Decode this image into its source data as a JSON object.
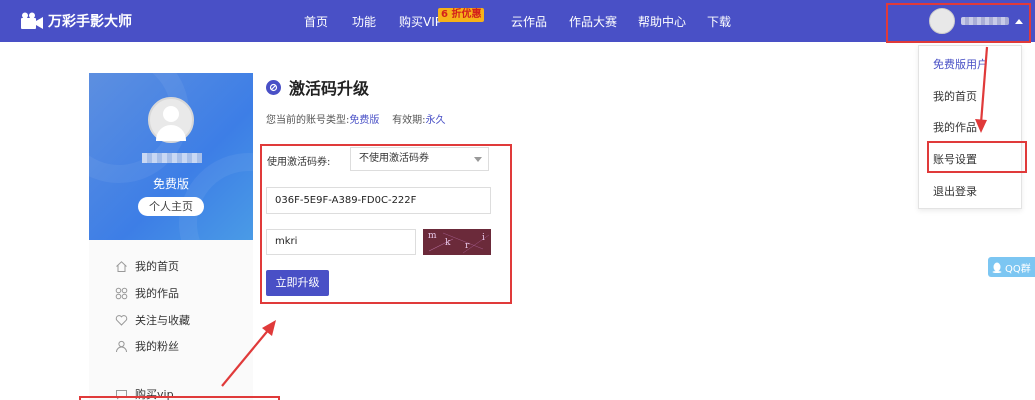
{
  "colors": {
    "brand": "#4950c6",
    "accent_red": "#e03a3a",
    "vip_badge": "#f6b21a",
    "link": "#4950c6"
  },
  "header": {
    "logo_text": "万彩手影大师",
    "logo_icon": "film-camera-icon",
    "nav": [
      "首页",
      "功能",
      "购买VIP",
      "云作品",
      "作品大赛",
      "帮助中心",
      "下载"
    ],
    "vip_badge": "6 折优惠"
  },
  "user_menu": {
    "plan_label": "免费版用户",
    "items": [
      "我的首页",
      "我的作品",
      "账号设置",
      "退出登录"
    ]
  },
  "profile": {
    "plan": "免费版",
    "home_button": "个人主页"
  },
  "sidebar": {
    "items": [
      {
        "label": "我的首页",
        "icon": "home-icon"
      },
      {
        "label": "我的作品",
        "icon": "grid-icon"
      },
      {
        "label": "关注与收藏",
        "icon": "heart-icon"
      },
      {
        "label": "我的粉丝",
        "icon": "user-icon"
      },
      {
        "label": "购买vip",
        "icon": "chat-icon"
      }
    ]
  },
  "main": {
    "title": "激活码升级",
    "account_type_label": "您当前的账号类型:",
    "account_type_value": "免费版",
    "validity_label": "有效期:",
    "validity_value": "永久",
    "coupon_label": "使用激活码券:",
    "coupon_select": "不使用激活码券",
    "activation_code": "036F-5E9F-A389-FD0C-222F",
    "captcha_input": "mkri",
    "captcha_chars": [
      "m",
      "k",
      "r",
      "i"
    ],
    "submit": "立即升级"
  },
  "float": {
    "qq": "QQ群"
  }
}
